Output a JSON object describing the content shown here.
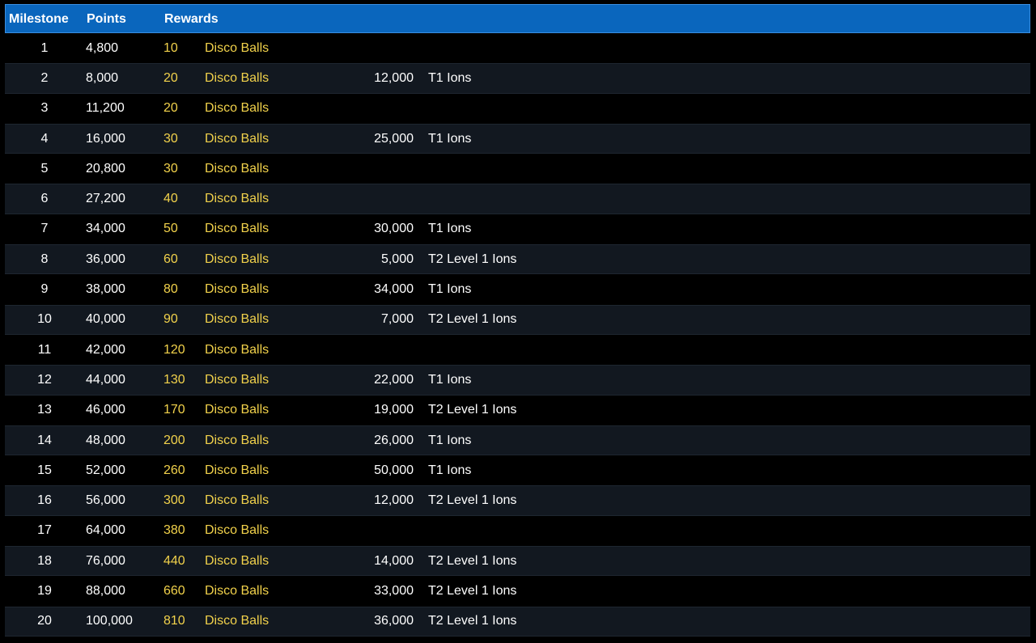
{
  "header": {
    "milestone": "Milestone",
    "points": "Points",
    "rewards": "Rewards"
  },
  "colors": {
    "header_bg": "#0a66bd",
    "reward_text": "#f2d24b",
    "alt_row_bg": "#121820"
  },
  "rows": [
    {
      "milestone": "1",
      "points": "4,800",
      "reward_qty": "10",
      "reward_item": "Disco Balls",
      "extra_qty": "",
      "extra_item": ""
    },
    {
      "milestone": "2",
      "points": "8,000",
      "reward_qty": "20",
      "reward_item": "Disco Balls",
      "extra_qty": "12,000",
      "extra_item": "T1 Ions"
    },
    {
      "milestone": "3",
      "points": "11,200",
      "reward_qty": "20",
      "reward_item": "Disco Balls",
      "extra_qty": "",
      "extra_item": ""
    },
    {
      "milestone": "4",
      "points": "16,000",
      "reward_qty": "30",
      "reward_item": "Disco Balls",
      "extra_qty": "25,000",
      "extra_item": "T1 Ions"
    },
    {
      "milestone": "5",
      "points": "20,800",
      "reward_qty": "30",
      "reward_item": "Disco Balls",
      "extra_qty": "",
      "extra_item": ""
    },
    {
      "milestone": "6",
      "points": "27,200",
      "reward_qty": "40",
      "reward_item": "Disco Balls",
      "extra_qty": "",
      "extra_item": ""
    },
    {
      "milestone": "7",
      "points": "34,000",
      "reward_qty": "50",
      "reward_item": "Disco Balls",
      "extra_qty": "30,000",
      "extra_item": "T1 Ions"
    },
    {
      "milestone": "8",
      "points": "36,000",
      "reward_qty": "60",
      "reward_item": "Disco Balls",
      "extra_qty": "5,000",
      "extra_item": "T2 Level 1 Ions"
    },
    {
      "milestone": "9",
      "points": "38,000",
      "reward_qty": "80",
      "reward_item": "Disco Balls",
      "extra_qty": "34,000",
      "extra_item": "T1 Ions"
    },
    {
      "milestone": "10",
      "points": "40,000",
      "reward_qty": "90",
      "reward_item": "Disco Balls",
      "extra_qty": "7,000",
      "extra_item": "T2 Level 1 Ions"
    },
    {
      "milestone": "11",
      "points": "42,000",
      "reward_qty": "120",
      "reward_item": "Disco Balls",
      "extra_qty": "",
      "extra_item": ""
    },
    {
      "milestone": "12",
      "points": "44,000",
      "reward_qty": "130",
      "reward_item": "Disco Balls",
      "extra_qty": "22,000",
      "extra_item": "T1 Ions"
    },
    {
      "milestone": "13",
      "points": "46,000",
      "reward_qty": "170",
      "reward_item": "Disco Balls",
      "extra_qty": "19,000",
      "extra_item": "T2 Level 1 Ions"
    },
    {
      "milestone": "14",
      "points": "48,000",
      "reward_qty": "200",
      "reward_item": "Disco Balls",
      "extra_qty": "26,000",
      "extra_item": "T1 Ions"
    },
    {
      "milestone": "15",
      "points": "52,000",
      "reward_qty": "260",
      "reward_item": "Disco Balls",
      "extra_qty": "50,000",
      "extra_item": "T1 Ions"
    },
    {
      "milestone": "16",
      "points": "56,000",
      "reward_qty": "300",
      "reward_item": "Disco Balls",
      "extra_qty": "12,000",
      "extra_item": "T2 Level 1 Ions"
    },
    {
      "milestone": "17",
      "points": "64,000",
      "reward_qty": "380",
      "reward_item": "Disco Balls",
      "extra_qty": "",
      "extra_item": ""
    },
    {
      "milestone": "18",
      "points": "76,000",
      "reward_qty": "440",
      "reward_item": "Disco Balls",
      "extra_qty": "14,000",
      "extra_item": "T2 Level 1 Ions"
    },
    {
      "milestone": "19",
      "points": "88,000",
      "reward_qty": "660",
      "reward_item": "Disco Balls",
      "extra_qty": "33,000",
      "extra_item": "T2 Level 1 Ions"
    },
    {
      "milestone": "20",
      "points": "100,000",
      "reward_qty": "810",
      "reward_item": "Disco Balls",
      "extra_qty": "36,000",
      "extra_item": "T2 Level 1 Ions"
    }
  ]
}
